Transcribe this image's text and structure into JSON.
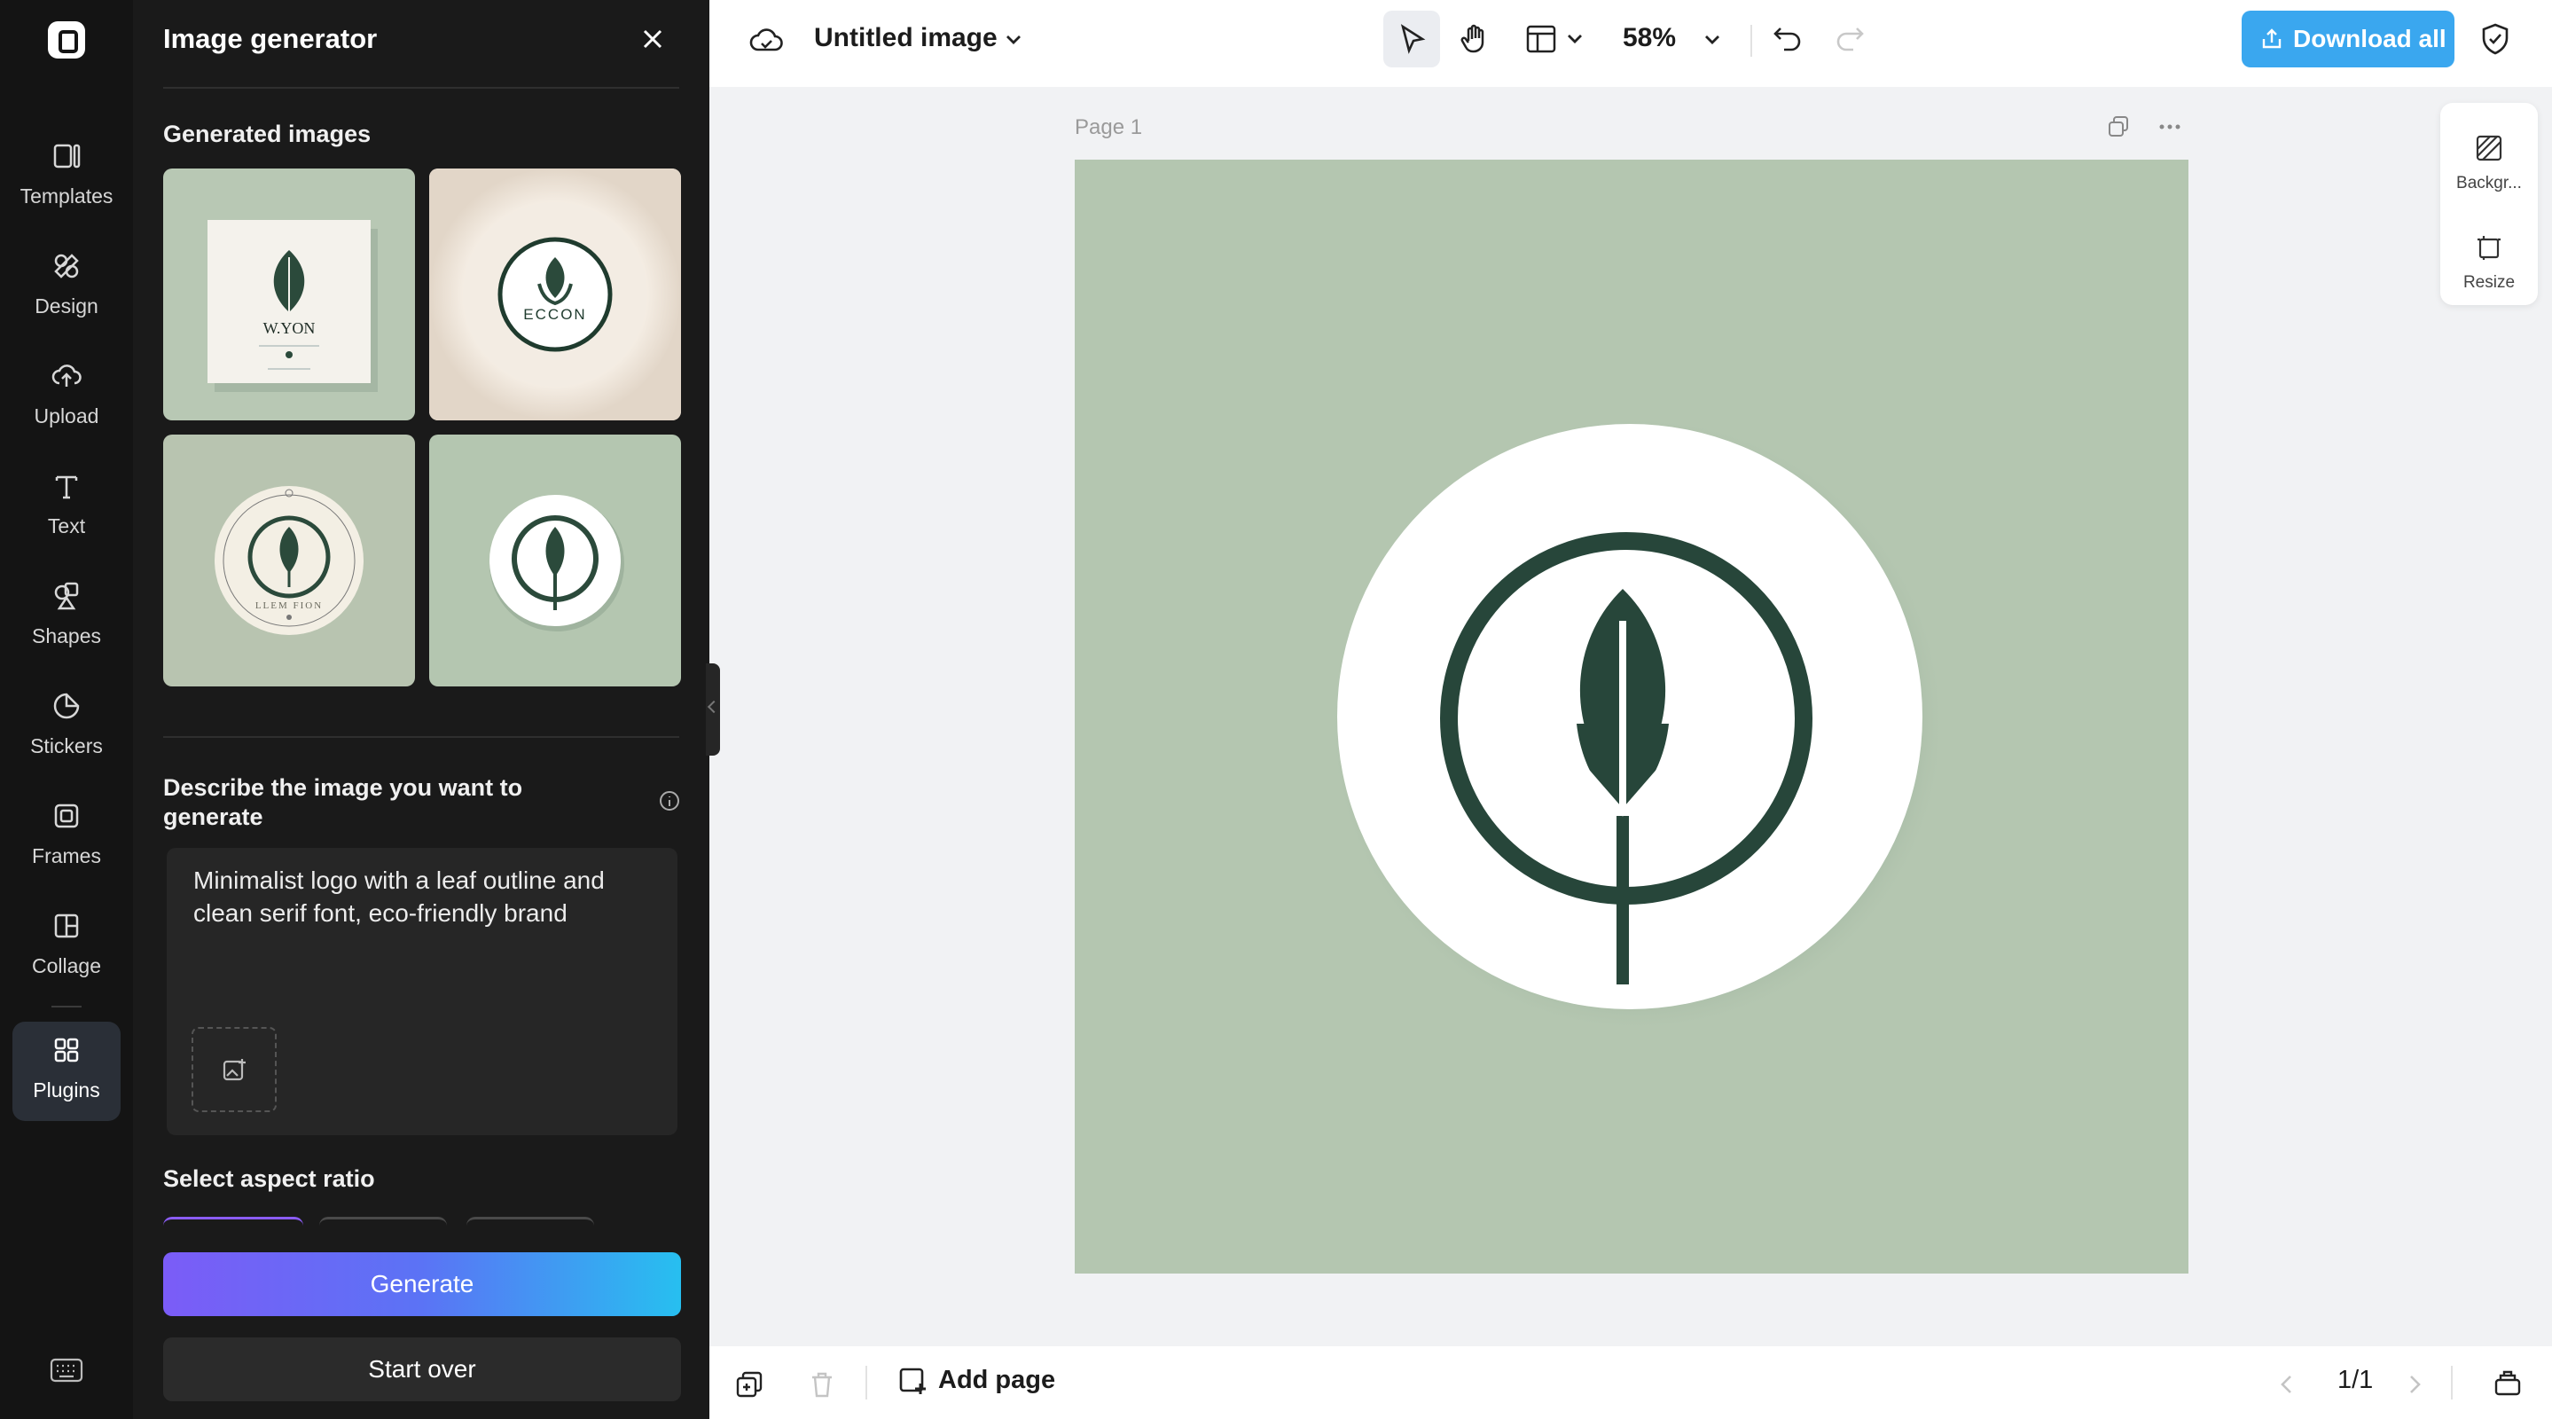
{
  "rail": {
    "items": [
      {
        "label": "Templates",
        "icon": "templates-icon"
      },
      {
        "label": "Design",
        "icon": "design-icon"
      },
      {
        "label": "Upload",
        "icon": "upload-icon"
      },
      {
        "label": "Text",
        "icon": "text-icon"
      },
      {
        "label": "Shapes",
        "icon": "shapes-icon"
      },
      {
        "label": "Stickers",
        "icon": "stickers-icon"
      },
      {
        "label": "Frames",
        "icon": "frames-icon"
      },
      {
        "label": "Collage",
        "icon": "collage-icon"
      },
      {
        "label": "Plugins",
        "icon": "plugins-icon",
        "active": true
      }
    ]
  },
  "panel": {
    "title": "Image generator",
    "generated_label": "Generated images",
    "thumbnails": [
      {
        "caption": "W.YON"
      },
      {
        "caption": "ECCON"
      },
      {
        "caption": "LLEM   FION"
      },
      {
        "caption": ""
      }
    ],
    "describe_label": "Describe the image you want to generate",
    "prompt_text": "Minimalist logo with a leaf outline and clean serif font, eco-friendly brand",
    "aspect_label": "Select aspect ratio",
    "generate_label": "Generate",
    "start_over_label": "Start over"
  },
  "topbar": {
    "doc_title": "Untitled image",
    "zoom": "58%",
    "download_label": "Download all"
  },
  "canvas": {
    "page_label": "Page 1",
    "side_tools": [
      {
        "label": "Backgr...",
        "icon": "background-icon"
      },
      {
        "label": "Resize",
        "icon": "resize-icon"
      }
    ]
  },
  "bottombar": {
    "add_page_label": "Add page",
    "pager": "1/1"
  },
  "colors": {
    "accent_blue": "#3aa7ef",
    "gradient_start": "#7b5cf7",
    "gradient_end": "#27bff0",
    "sage": "#b4c6b0",
    "leaf": "#2b4a3b"
  }
}
